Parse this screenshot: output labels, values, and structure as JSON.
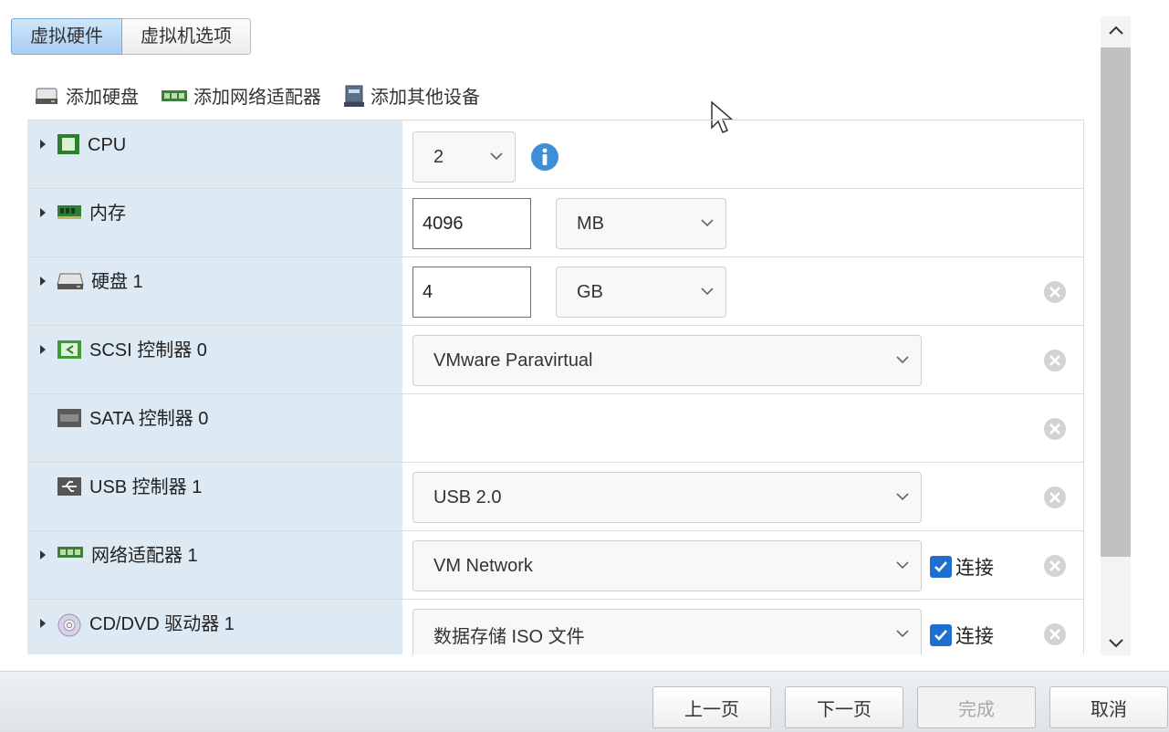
{
  "tabs": [
    {
      "label": "虚拟硬件",
      "active": true
    },
    {
      "label": "虚拟机选项",
      "active": false
    }
  ],
  "toolbar": {
    "add_disk": "添加硬盘",
    "add_network_adapter": "添加网络适配器",
    "add_other_device": "添加其他设备"
  },
  "rows": {
    "cpu": {
      "label": "CPU",
      "value": "2"
    },
    "memory": {
      "label": "内存",
      "value": "4096",
      "unit": "MB"
    },
    "disk": {
      "label": "硬盘 1",
      "value": "4",
      "unit": "GB"
    },
    "scsi": {
      "label": "SCSI 控制器 0",
      "value": "VMware Paravirtual"
    },
    "sata": {
      "label": "SATA 控制器 0"
    },
    "usb": {
      "label": "USB 控制器 1",
      "value": "USB 2.0"
    },
    "network": {
      "label": "网络适配器 1",
      "value": "VM Network",
      "connect_label": "连接",
      "connected": true
    },
    "cddvd": {
      "label": "CD/DVD 驱动器 1",
      "value": "数据存储 ISO 文件",
      "connect_label": "连接",
      "connected": true
    }
  },
  "footer": {
    "back": "上一页",
    "next": "下一页",
    "finish": "完成",
    "cancel": "取消"
  },
  "colors": {
    "label_bg": "#dde9f3",
    "tab_active": "#a8cdf2",
    "checkbox": "#1f6fd0",
    "info": "#3d8fd8"
  }
}
